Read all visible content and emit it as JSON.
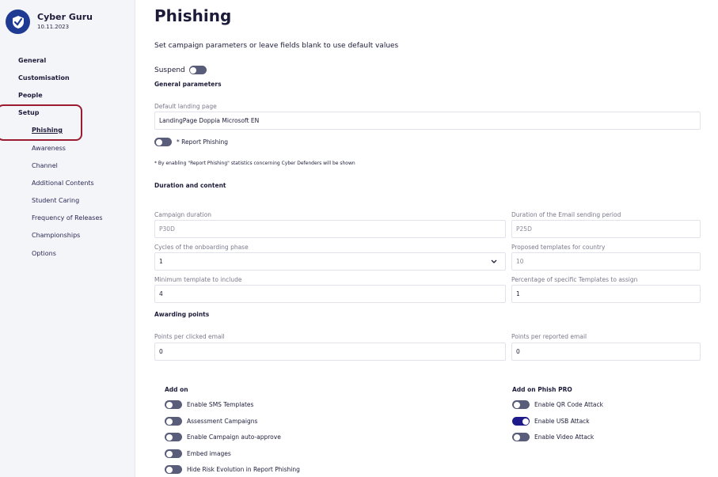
{
  "brand": {
    "name": "Cyber Guru",
    "date": "10.11.2023"
  },
  "nav": {
    "items": [
      {
        "label": "General"
      },
      {
        "label": "Customisation"
      },
      {
        "label": "People"
      },
      {
        "label": "Setup"
      }
    ],
    "sub_items": [
      {
        "label": "Phishing"
      },
      {
        "label": "Awareness"
      },
      {
        "label": "Channel"
      },
      {
        "label": "Additional Contents"
      },
      {
        "label": "Student Caring"
      },
      {
        "label": "Frequency of Releases"
      },
      {
        "label": "Championships"
      },
      {
        "label": "Options"
      }
    ]
  },
  "page": {
    "title": "Phishing",
    "subtitle": "Set campaign parameters or leave fields blank to use default values",
    "suspend_label": "Suspend",
    "suspend_on": false
  },
  "general": {
    "heading": "General parameters",
    "landing_label": "Default landing page",
    "landing_value": "LandingPage Doppia Microsoft EN",
    "report_label": "* Report Phishing",
    "report_on": false,
    "note": "* By enabling \"Report Phishing\" statistics concerning Cyber Defenders will be shown"
  },
  "duration": {
    "heading": "Duration and content",
    "campaign_label": "Campaign duration",
    "campaign_placeholder": "P30D",
    "email_period_label": "Duration of the Email sending period",
    "email_period_placeholder": "P25D",
    "cycles_label": "Cycles of the onboarding phase",
    "cycles_value": "1",
    "proposed_label": "Proposed templates for country",
    "proposed_placeholder": "10",
    "min_label": "Minimum template to include",
    "min_value": "4",
    "pct_label": "Percentage of specific Templates to assign",
    "pct_value": "1"
  },
  "points": {
    "heading": "Awarding points",
    "clicked_label": "Points per clicked email",
    "clicked_value": "0",
    "reported_label": "Points per reported email",
    "reported_value": "0"
  },
  "addon": {
    "heading": "Add on",
    "items": [
      {
        "label": "Enable SMS Templates",
        "on": false
      },
      {
        "label": "Assessment Campaigns",
        "on": false
      },
      {
        "label": "Enable Campaign auto-approve",
        "on": false
      },
      {
        "label": "Embed images",
        "on": false
      },
      {
        "label": "Hide Risk Evolution in Report Phishing",
        "on": false
      }
    ]
  },
  "pro": {
    "heading": "Add on Phish PRO",
    "items": [
      {
        "label": "Enable QR Code Attack",
        "on": false
      },
      {
        "label": "Enable USB Attack",
        "on": true
      },
      {
        "label": "Enable Video Attack",
        "on": false
      }
    ]
  },
  "colors": {
    "accent": "#1f1a8a",
    "highlight": "#9b1b30",
    "logo": "#1f3a93"
  },
  "icons": {
    "logo": "shield-check-icon",
    "dropdown": "chevron-down-icon"
  }
}
